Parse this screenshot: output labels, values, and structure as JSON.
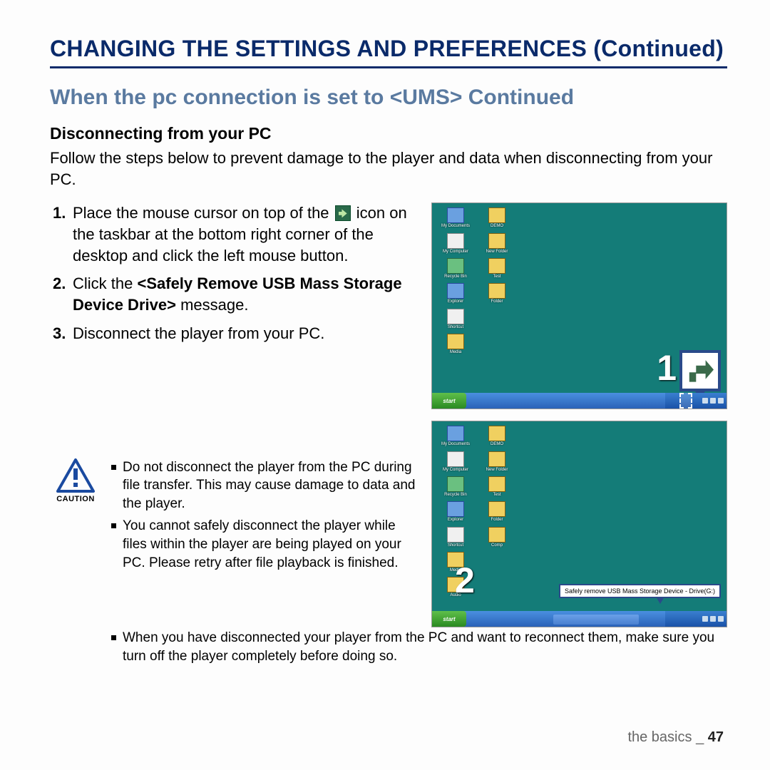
{
  "title": "CHANGING THE SETTINGS AND PREFERENCES (Continued)",
  "section": "When the pc connection is set to <UMS> Continued",
  "subsection": "Disconnecting from your PC",
  "intro": "Follow the steps below to prevent damage to the player and data when disconnecting from your PC.",
  "steps": {
    "s1_num": "1.",
    "s1a": "Place the mouse cursor on top of the ",
    "s1b": " icon on the taskbar at the bottom right corner of the desktop and click the left mouse button.",
    "s2_num": "2.",
    "s2a": "Click the ",
    "s2b": "<Safely Remove USB Mass Storage Device Drive>",
    "s2c": " message.",
    "s3_num": "3.",
    "s3": "Disconnect the player from your PC."
  },
  "caution_label": "CAUTION",
  "caution": {
    "c1": "Do not disconnect the player from the PC during file transfer. This may cause damage to data and the player.",
    "c2": "You cannot safely disconnect the player while files within the player are being played on your PC. Please retry after file playback is finished.",
    "c3": "When you have disconnected your player from the PC and want to reconnect them, make sure you turn off the player completely before doing so."
  },
  "callouts": {
    "n1": "1",
    "n2": "2"
  },
  "tooltip_text": "Safely remove USB Mass Storage Device - Drive(G:)",
  "start_label": "start",
  "footer": {
    "section": "the basics",
    "sep": "_",
    "page": "47"
  }
}
